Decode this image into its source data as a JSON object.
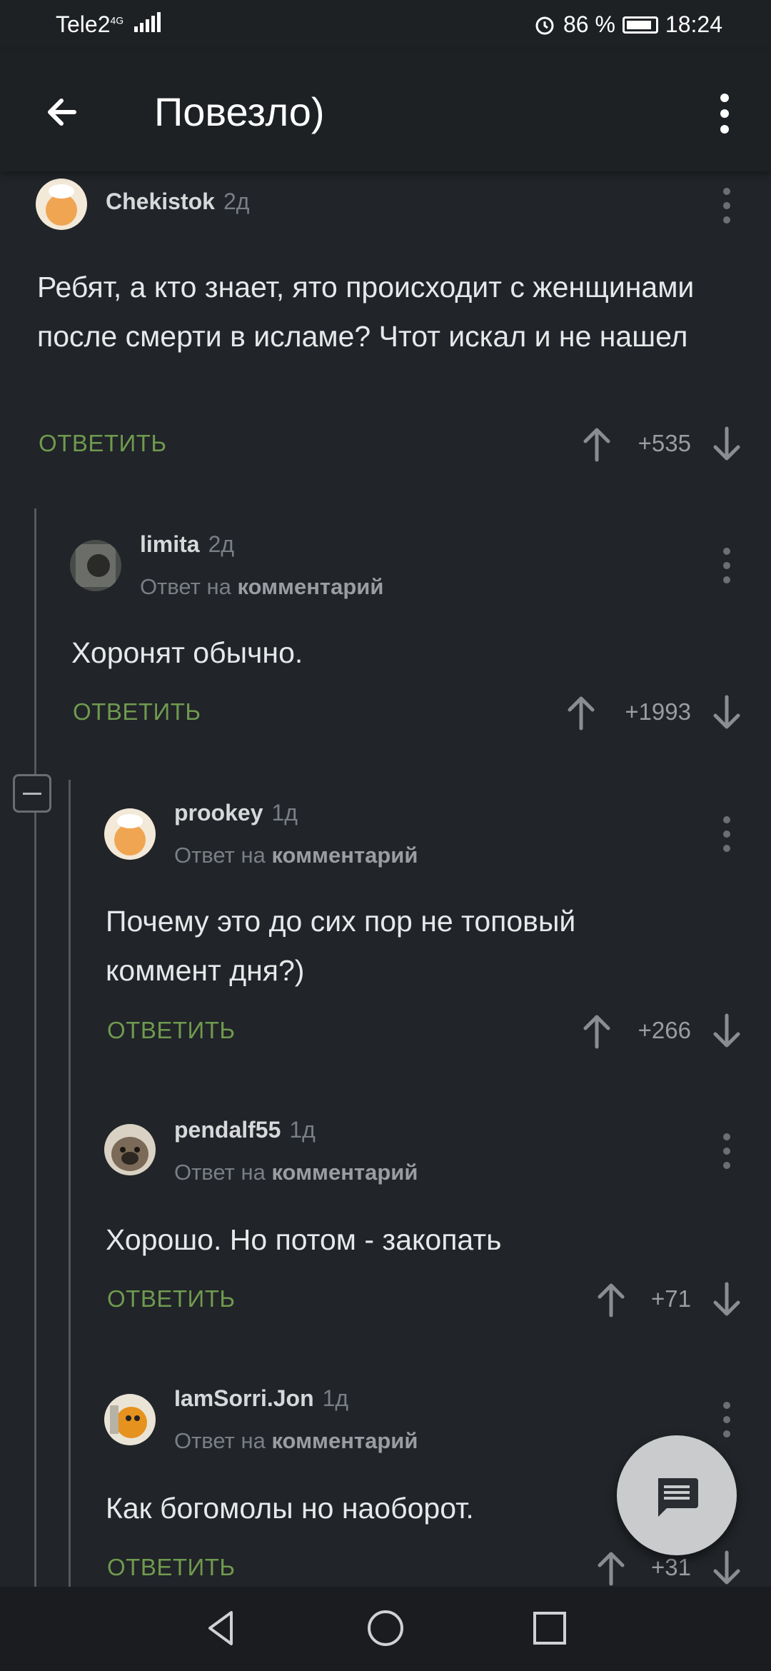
{
  "status_bar": {
    "carrier": "Tele2",
    "network": "4G",
    "battery": "86 %",
    "time": "18:24"
  },
  "app_bar": {
    "title": "Повезло)"
  },
  "reply_label": "ОТВЕТИТЬ",
  "reply_to_prefix": "Ответ на",
  "reply_to_link": "комментарий",
  "comments": [
    {
      "user": "Chekistok",
      "ago": "2д",
      "text": "Ребят, а кто знает, ято происходит с женщинами после смерти в исламе? Чтот искал и не нашел",
      "score": "+535"
    },
    {
      "user": "limita",
      "ago": "2д",
      "text": "Хоронят обычно.",
      "score": "+1993"
    },
    {
      "user": "prookey",
      "ago": "1д",
      "text": "Почему это до сих пор не топовый коммент дня?)",
      "score": "+266"
    },
    {
      "user": "pendalf55",
      "ago": "1д",
      "text": "Хорошо. Но потом - закопать",
      "score": "+71"
    },
    {
      "user": "IamSorri.Jon",
      "ago": "1д",
      "text": "Как богомолы но наоборот.",
      "score": "+31"
    }
  ],
  "icons": {
    "back": "arrow-left-icon",
    "more": "more-vertical-icon",
    "upvote": "arrow-up-icon",
    "downvote": "arrow-down-icon",
    "fab": "comment-icon"
  },
  "colors": {
    "background": "#212428",
    "accent_reply": "#6f9a4f",
    "muted": "#7a7f85"
  }
}
